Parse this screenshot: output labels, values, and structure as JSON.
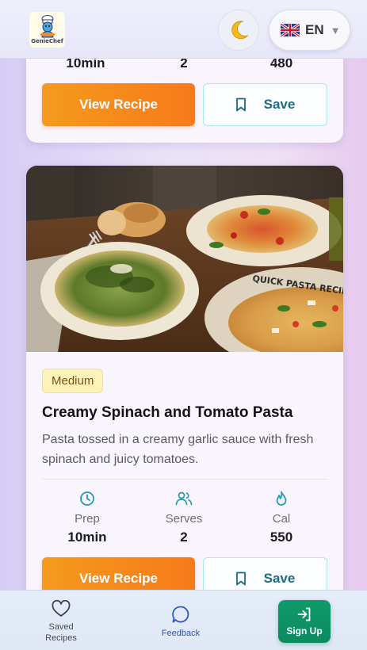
{
  "header": {
    "logo_text": "GenieChef",
    "theme_icon": "moon-icon",
    "language": {
      "code": "EN",
      "flag_icon": "uk-flag-icon",
      "caret_icon": "caret-down-icon"
    }
  },
  "cards": [
    {
      "stats": {
        "prep": "10min",
        "serves": "2",
        "cal": "480"
      },
      "view_label": "View Recipe",
      "save_label": "Save"
    },
    {
      "image_alt": "Plates of spinach fusilli, tomato spaghetti and quick pasta recipe penne",
      "image_plate_text": "QUICK PASTA RECIPE",
      "difficulty": "Medium",
      "title": "Creamy Spinach and Tomato Pasta",
      "description": "Pasta tossed in a creamy garlic sauce with fresh spinach and juicy tomatoes.",
      "stats": [
        {
          "icon": "clock-icon",
          "label": "Prep",
          "value": "10min"
        },
        {
          "icon": "users-icon",
          "label": "Serves",
          "value": "2"
        },
        {
          "icon": "flame-icon",
          "label": "Cal",
          "value": "550"
        }
      ],
      "view_label": "View Recipe",
      "save_label": "Save"
    }
  ],
  "bottom_nav": {
    "saved": {
      "label_line1": "Saved",
      "label_line2": "Recipes",
      "icon": "heart-icon"
    },
    "feedback": {
      "label": "Feedback",
      "icon": "chat-bubble-icon"
    },
    "signup": {
      "label": "Sign Up",
      "icon": "login-icon"
    }
  },
  "colors": {
    "accent_orange": "#f7861b",
    "save_text": "#1d6b82",
    "signup_green": "#0f9a6b",
    "feedback_blue": "#2c56b8"
  }
}
